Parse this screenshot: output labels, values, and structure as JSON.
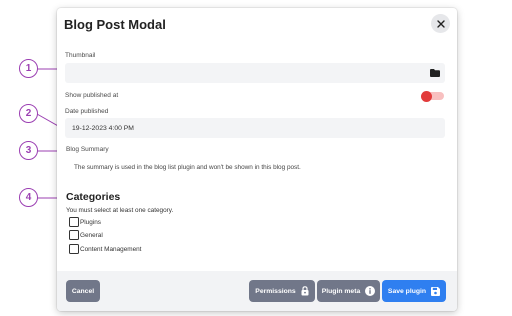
{
  "callouts": [
    "1",
    "2",
    "3",
    "4"
  ],
  "modal": {
    "title": "Blog Post Modal"
  },
  "fields": {
    "thumbnail_label": "Thumbnail",
    "thumbnail_value": "",
    "show_published_label": "Show published at",
    "show_published_on": false,
    "date_label": "Date published",
    "date_value": "19-12-2023 4:00 PM",
    "summary_label": "Blog Summary",
    "summary_help": "The summary is used in the blog list plugin and won't be shown in this blog post."
  },
  "categories": {
    "title": "Categories",
    "help": "You must select at least one category.",
    "items": [
      {
        "label": "Plugins",
        "checked": false
      },
      {
        "label": "General",
        "checked": false
      },
      {
        "label": "Content Management",
        "checked": false
      }
    ]
  },
  "footer": {
    "cancel_label": "Cancel",
    "permissions_label": "Permissions",
    "plugin_meta_label": "Plugin meta",
    "save_label": "Save plugin"
  },
  "colors": {
    "callout": "#9b3fb2",
    "toggle_off": "#e23b3b",
    "save": "#2f7ff0",
    "secondary_button": "#717789"
  },
  "icons": [
    "close-icon",
    "folder-icon",
    "lock-icon",
    "info-icon",
    "save-icon"
  ]
}
